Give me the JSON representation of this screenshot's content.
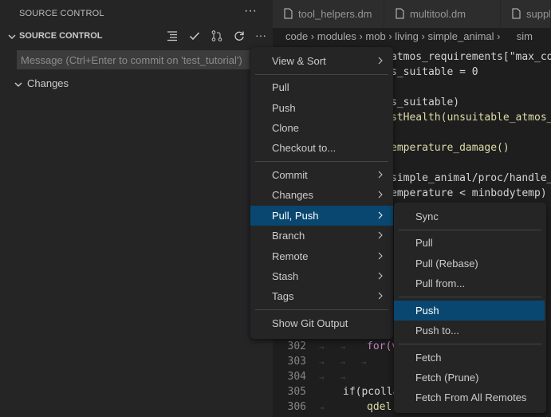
{
  "sidebar": {
    "title": "SOURCE CONTROL",
    "section_label": "SOURCE CONTROL",
    "commit_placeholder": "Message (Ctrl+Enter to commit on 'test_tutorial')",
    "changes_label": "Changes"
  },
  "tabs": [
    {
      "label": "tool_helpers.dm"
    },
    {
      "label": "multitool.dm"
    },
    {
      "label": "suppl"
    }
  ],
  "breadcrumb": "code › modules › mob › living › simple_animal ›   sim",
  "editor": {
    "lines": [
      {
        "text": "atmos_requirements[\"max_co"
      },
      {
        "text": "s_suitable = 0"
      },
      {
        "text": ""
      },
      {
        "text": "s_suitable)"
      },
      {
        "text": "stHealth(unsuitable_atmos_"
      },
      {
        "text": ""
      },
      {
        "text": "emperature_damage()"
      },
      {
        "text": ""
      },
      {
        "text": "simple_animal/proc/handle_"
      },
      {
        "text": "emperature < minbodytemp)"
      }
    ],
    "line_numbers": [
      "302",
      "303",
      "304",
      "305",
      "306"
    ],
    "bottom_code": [
      "for(v",
      "",
      "",
      "if(pcolla",
      "qdel("
    ]
  },
  "menu_main": {
    "items": [
      {
        "label": "View & Sort",
        "submenu": true
      },
      {
        "label": "Pull"
      },
      {
        "label": "Push"
      },
      {
        "label": "Clone"
      },
      {
        "label": "Checkout to..."
      },
      {
        "label": "Commit",
        "submenu": true
      },
      {
        "label": "Changes",
        "submenu": true
      },
      {
        "label": "Pull, Push",
        "submenu": true,
        "selected": true
      },
      {
        "label": "Branch",
        "submenu": true
      },
      {
        "label": "Remote",
        "submenu": true
      },
      {
        "label": "Stash",
        "submenu": true
      },
      {
        "label": "Tags",
        "submenu": true
      },
      {
        "label": "Show Git Output"
      }
    ]
  },
  "menu_sub": {
    "items": [
      {
        "label": "Sync"
      },
      {
        "label": "Pull"
      },
      {
        "label": "Pull (Rebase)"
      },
      {
        "label": "Pull from..."
      },
      {
        "label": "Push",
        "selected": true
      },
      {
        "label": "Push to..."
      },
      {
        "label": "Fetch"
      },
      {
        "label": "Fetch (Prune)"
      },
      {
        "label": "Fetch From All Remotes"
      }
    ]
  },
  "colors": {
    "selection": "#094771",
    "menu_bg": "#252526",
    "sidebar_bg": "#252526",
    "editor_bg": "#1e1e1e"
  }
}
